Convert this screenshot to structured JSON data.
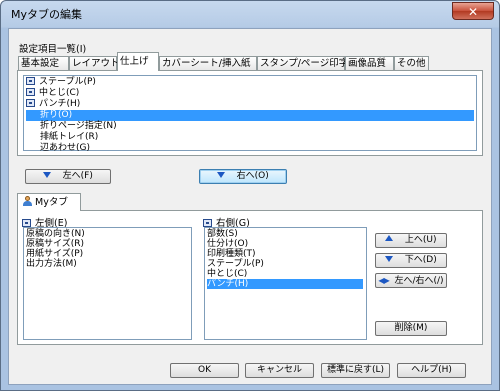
{
  "window": {
    "title": "Myタブの編集",
    "close": "✕"
  },
  "settings": {
    "label": "設定項目一覧(I)",
    "tabs": [
      "基本設定",
      "レイアウト",
      "仕上げ",
      "カバーシート/挿入紙",
      "スタンプ/ページ印字",
      "画像品質",
      "その他"
    ],
    "active_tab": "仕上げ",
    "items": [
      "ステープル(P)",
      "中とじ(C)",
      "パンチ(H)",
      "折り(O)",
      "折りページ指定(N)",
      "排紙トレイ(R)",
      "辺あわせ(G)"
    ],
    "selected_item": "折り(O)",
    "left_button": "左へ(F)",
    "right_button": "右へ(O)"
  },
  "mytab": {
    "tab_label": "Myタブ",
    "left_label": "左側(E)",
    "left_items": [
      "原稿の向き(N)",
      "原稿サイズ(R)",
      "用紙サイズ(P)",
      "出力方法(M)"
    ],
    "right_label": "右側(G)",
    "right_items": [
      "部数(S)",
      "仕分け(O)",
      "印刷種類(T)",
      "ステープル(P)",
      "中とじ(C)",
      "パンチ(H)"
    ],
    "right_selected": "パンチ(H)",
    "up_button": "上へ(U)",
    "down_button": "下へ(D)",
    "swap_button": "左へ/右へ(/)",
    "delete_button": "削除(M)"
  },
  "footer": {
    "ok": "OK",
    "cancel": "キャンセル",
    "reset": "標準に戻す(L)",
    "help": "ヘルプ(H)"
  }
}
